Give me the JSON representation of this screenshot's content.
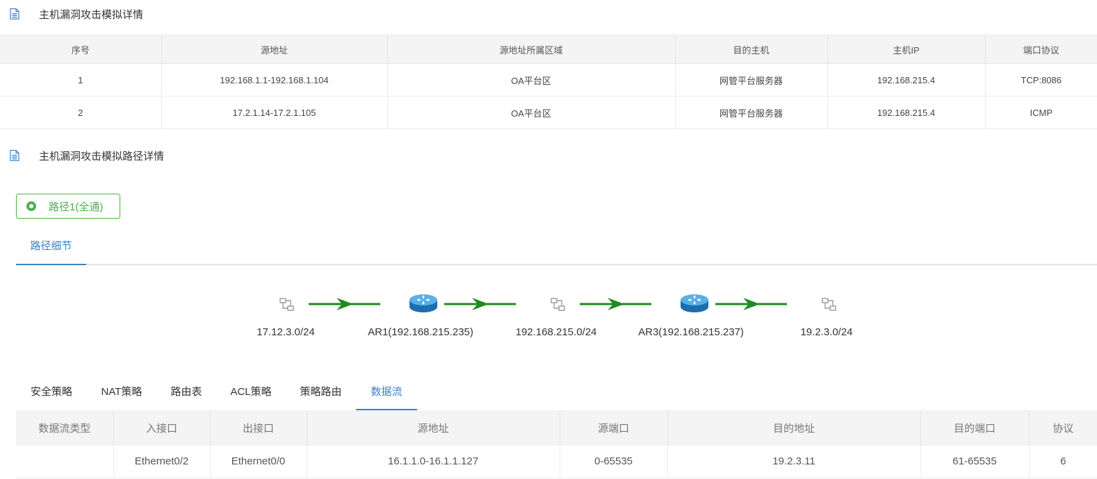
{
  "section1": {
    "title": "主机漏洞攻击模拟详情",
    "icon": "document-icon"
  },
  "host_table": {
    "headers": [
      "序号",
      "源地址",
      "源地址所属区域",
      "目的主机",
      "主机IP",
      "端口协议"
    ],
    "rows": [
      [
        "1",
        "192.168.1.1-192.168.1.104",
        "OA平台区",
        "网管平台服务器",
        "192.168.215.4",
        "TCP:8086"
      ],
      [
        "2",
        "17.2.1.14-17.2.1.105",
        "OA平台区",
        "网管平台服务器",
        "192.168.215.4",
        "ICMP"
      ]
    ]
  },
  "section2": {
    "title": "主机漏洞攻击模拟路径详情",
    "icon": "document-icon"
  },
  "path_tag": {
    "label": "路径1(全通)",
    "status_color": "#4caf50"
  },
  "detail_tab": {
    "label": "路径细节"
  },
  "topology": {
    "nodes": [
      {
        "type": "subnet",
        "icon": "network-subnet-icon",
        "label": "17.12.3.0/24"
      },
      {
        "type": "router",
        "icon": "router-icon",
        "label": "AR1(192.168.215.235)"
      },
      {
        "type": "subnet",
        "icon": "network-subnet-icon",
        "label": "192.168.215.0/24"
      },
      {
        "type": "router",
        "icon": "router-icon",
        "label": "AR3(192.168.215.237)"
      },
      {
        "type": "subnet",
        "icon": "network-subnet-icon",
        "label": "19.2.3.0/24"
      }
    ],
    "arrow_color": "#1f8a1f"
  },
  "sub_tabs": {
    "items": [
      "安全策略",
      "NAT策略",
      "路由表",
      "ACL策略",
      "策略路由",
      "数据流"
    ],
    "active": "数据流"
  },
  "flow_table": {
    "headers": [
      "数据流类型",
      "入接口",
      "出接口",
      "源地址",
      "源端口",
      "目的地址",
      "目的端口",
      "协议"
    ],
    "rows": [
      [
        "",
        "Ethernet0/2",
        "Ethernet0/0",
        "16.1.1.0-16.1.1.127",
        "0-65535",
        "19.2.3.11",
        "61-65535",
        "6"
      ]
    ]
  },
  "colors": {
    "accent": "#3d7fc1",
    "success": "#4caf50",
    "header_bg": "#f4f4f4"
  }
}
